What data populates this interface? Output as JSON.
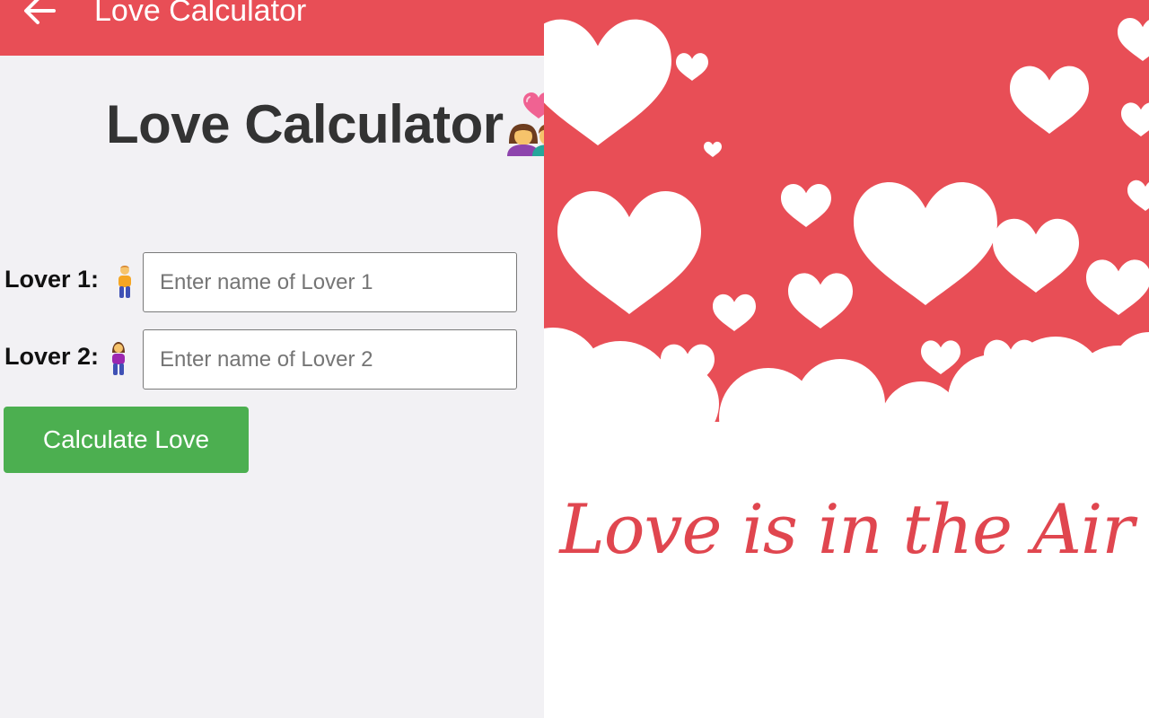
{
  "app_bar": {
    "title": "Love Calculator",
    "back_icon": "arrow-left-icon"
  },
  "main": {
    "heading": "Love Calculator",
    "heading_icon": "couple-with-heart-icon",
    "lover1": {
      "label": "Lover 1:",
      "icon": "person-icon",
      "value": "",
      "placeholder": "Enter name of Lover 1"
    },
    "lover2": {
      "label": "Lover 2:",
      "icon": "woman-icon",
      "value": "",
      "placeholder": "Enter name of Lover 2"
    },
    "calculate_label": "Calculate Love"
  },
  "banner": {
    "tagline": "Love is in the Air"
  },
  "colors": {
    "app_bar": "#e84e56",
    "background": "#f2f1f4",
    "button": "#4caf50",
    "banner_red": "#e84e56",
    "tagline": "#e0464f"
  }
}
